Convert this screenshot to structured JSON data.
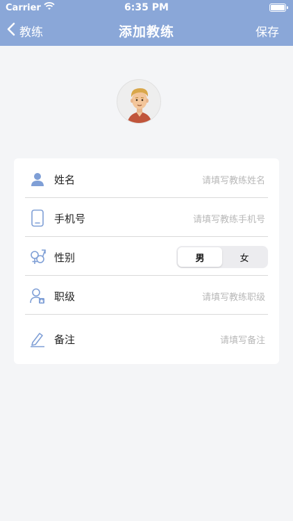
{
  "status_bar": {
    "carrier": "Carrier",
    "time": "6:35 PM"
  },
  "nav": {
    "back_label": "教练",
    "title": "添加教练",
    "save_label": "保存"
  },
  "form": {
    "name": {
      "label": "姓名",
      "placeholder": "请填写教练姓名"
    },
    "phone": {
      "label": "手机号",
      "placeholder": "请填写教练手机号"
    },
    "gender": {
      "label": "性别",
      "options": [
        "男",
        "女"
      ],
      "selected": "男"
    },
    "rank": {
      "label": "职级",
      "placeholder": "请填写教练职级"
    },
    "note": {
      "label": "备注",
      "placeholder": "请填写备注"
    }
  },
  "colors": {
    "nav_bg": "#8aa7d8",
    "icon": "#7f9fd6",
    "page_bg": "#f4f5f7"
  },
  "icons": [
    "wifi-icon",
    "battery-icon",
    "back-chevron-icon",
    "avatar",
    "person-icon",
    "phone-icon",
    "gender-icon",
    "rank-icon",
    "pencil-icon"
  ]
}
